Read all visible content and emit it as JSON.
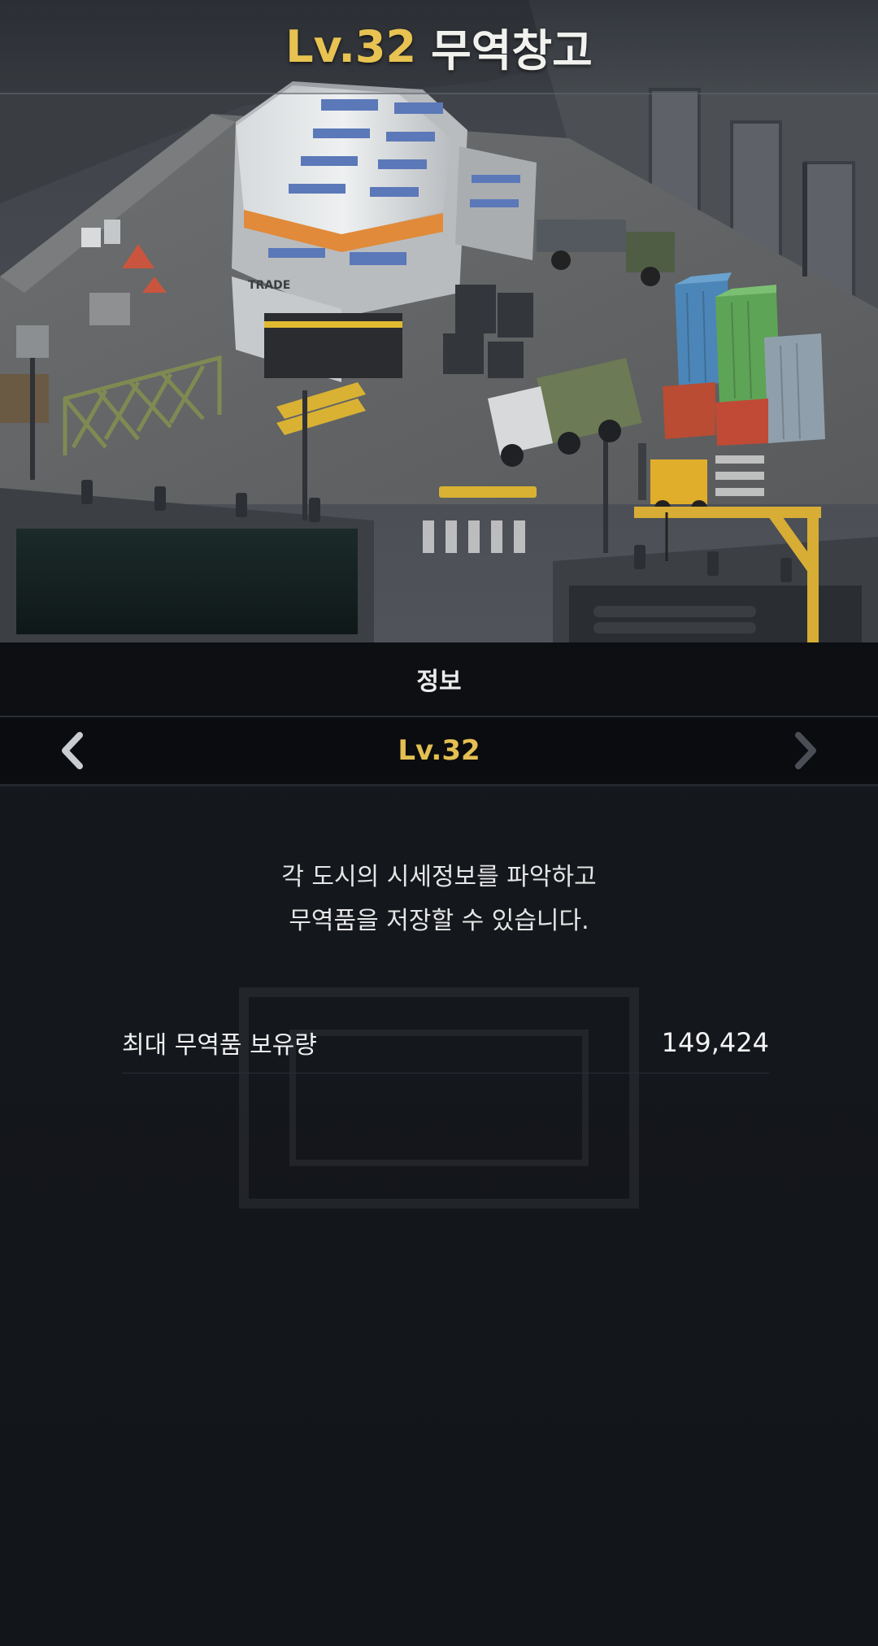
{
  "header": {
    "level": "Lv.32",
    "building_name": "무역창고"
  },
  "tabs": {
    "info_label": "정보"
  },
  "level_selector": {
    "level": "Lv.32",
    "prev_icon": "chevron-left-icon",
    "next_icon": "chevron-right-icon"
  },
  "scene": {
    "building_sign": "TRADE"
  },
  "description": {
    "line1": "각 도시의 시세정보를 파악하고",
    "line2": "무역품을 저장할 수 있습니다."
  },
  "stats": [
    {
      "label": "최대 무역품 보유량",
      "value": "149,424"
    }
  ],
  "colors": {
    "accent_gold": "#e4bf52",
    "background": "#14171c",
    "text": "#ececec"
  }
}
